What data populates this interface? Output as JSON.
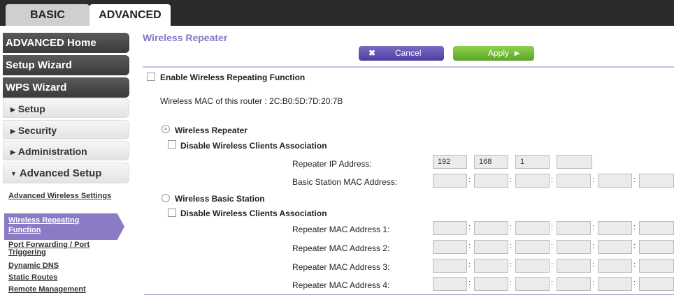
{
  "tabs": {
    "basic": "BASIC",
    "advanced": "ADVANCED"
  },
  "sidebar": {
    "buttons": [
      "ADVANCED Home",
      "Setup Wizard",
      "WPS Wizard"
    ],
    "sections": [
      "Setup",
      "Security",
      "Administration",
      "Advanced Setup"
    ],
    "links": [
      "Advanced Wireless Settings",
      "Wireless Repeating Function",
      "Port Forwarding / Port Triggering",
      "Dynamic DNS",
      "Static Routes",
      "Remote Management"
    ],
    "active_link": "Wireless Repeating Function"
  },
  "main": {
    "title": "Wireless Repeater",
    "cancel_label": "Cancel",
    "apply_label": "Apply",
    "enable_label": "Enable Wireless Repeating Function",
    "mac_text": "Wireless MAC of this router : 2C:B0:5D:7D:20:7B",
    "repeater_radio": "Wireless Repeater",
    "disable_assoc_1": "Disable Wireless Clients Association",
    "repeater_ip_label": "Repeater IP Address:",
    "ip_values": [
      "192",
      "168",
      "1",
      ""
    ],
    "basic_station_mac_label": "Basic Station MAC Address:",
    "basic_station_radio": "Wireless Basic Station",
    "disable_assoc_2": "Disable Wireless Clients Association",
    "repeater_mac_labels": [
      "Repeater MAC Address 1:",
      "Repeater MAC Address 2:",
      "Repeater MAC Address 3:",
      "Repeater MAC Address 4:"
    ]
  },
  "colors": {
    "accent": "#8476c4",
    "apply": "#6bb536",
    "cancel": "#5a4bb0"
  }
}
